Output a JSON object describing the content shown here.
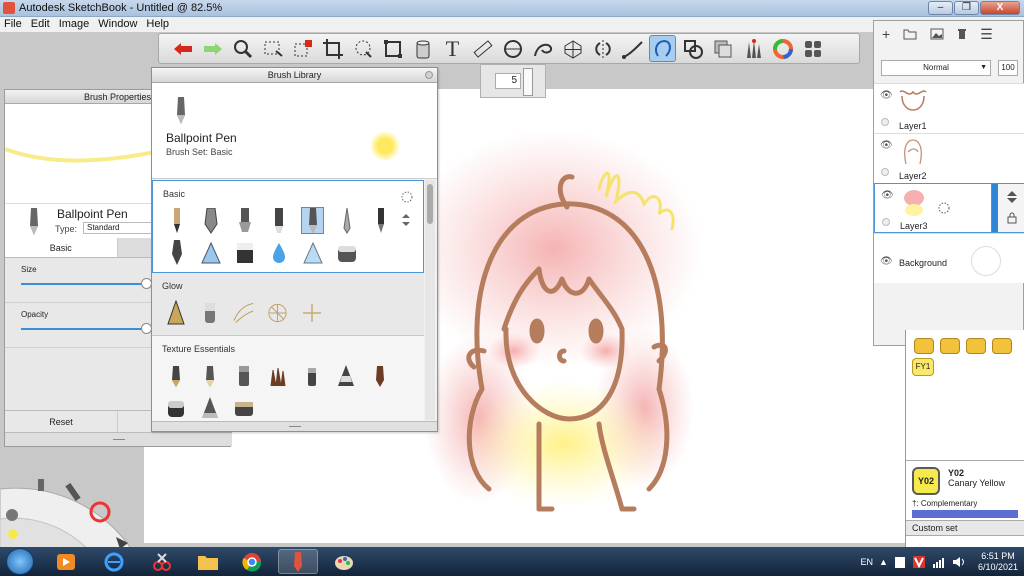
{
  "window": {
    "title": "Autodesk SketchBook - Untitled @ 82.5%",
    "controls": [
      "–",
      "❐",
      "X"
    ]
  },
  "menu": [
    "File",
    "Edit",
    "Image",
    "Window",
    "Help"
  ],
  "toolbar": {
    "tools": [
      "undo-icon",
      "redo-icon",
      "zoom-icon",
      "select-icon",
      "crop-icon",
      "distort-icon",
      "fill-icon",
      "text-icon",
      "ruler-icon",
      "ellipse-icon",
      "french-curve-icon",
      "perspective-icon",
      "symmetry-icon",
      "stroke-icon",
      "pen-icon",
      "shape-icon",
      "copic-icon",
      "brush-palette-icon",
      "color-wheel-icon",
      "layout-icon"
    ],
    "text_tool_glyph": "T"
  },
  "brush_size_mini": {
    "value": "5"
  },
  "brush_properties": {
    "title": "Brush Properties",
    "brush_name": "Ballpoint Pen",
    "type_label": "Type:",
    "type_value": "Standard",
    "tabs": [
      "Basic",
      ""
    ],
    "size_label": "Size",
    "opacity_label": "Opacity",
    "footer": [
      "Reset",
      ""
    ]
  },
  "brush_library": {
    "title": "Brush Library",
    "brush_name": "Ballpoint Pen",
    "brush_set": "Brush Set: Basic",
    "sections": [
      "Basic",
      "Glow",
      "Texture Essentials"
    ]
  },
  "layers": {
    "blend_mode": "Normal",
    "opacity": "100",
    "items": [
      "Layer1",
      "Layer2",
      "Layer3",
      "Background"
    ]
  },
  "copic": {
    "fy_label": "FY1",
    "selected_code": "Y02",
    "selected_name": "Canary Yellow",
    "complementary_label": "†: Complementary",
    "custom_set_label": "Custom set"
  },
  "taskbar": {
    "language": "EN",
    "time": "6:51 PM",
    "date": "6/10/2021"
  },
  "colors": {
    "accent": "#4d95d8",
    "selection_blue": "#2f86d6",
    "canary_yellow": "#f6e94d",
    "line_brown": "#b57d5e",
    "cheek_pink": "#f4a0a0"
  }
}
